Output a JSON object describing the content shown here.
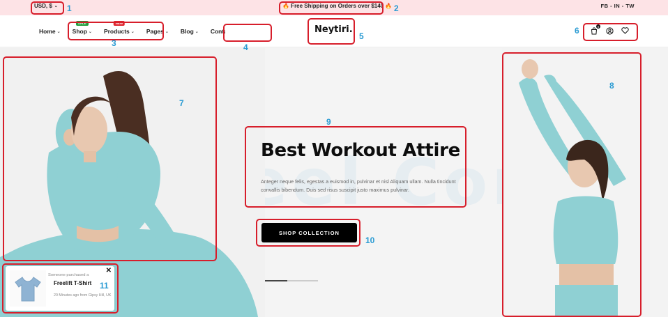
{
  "topbar": {
    "currency": "USD, $",
    "shipping_text": "🔥 Free Shipping on Orders over $140 🔥",
    "social": "FB - IN - TW"
  },
  "nav": {
    "items": [
      {
        "label": "Home",
        "has_dropdown": true
      },
      {
        "label": "Shop",
        "has_dropdown": true,
        "badge": "SALE"
      },
      {
        "label": "Products",
        "has_dropdown": true,
        "badge": "NEW"
      },
      {
        "label": "Pages",
        "has_dropdown": true
      },
      {
        "label": "Blog",
        "has_dropdown": true
      },
      {
        "label": "Contact",
        "has_dropdown": false
      }
    ]
  },
  "header": {
    "logo": "Neytiri.",
    "cart_count": "0",
    "icons": [
      "cart-icon",
      "user-icon",
      "heart-icon"
    ]
  },
  "hero": {
    "watermark": "Feel Comfy",
    "title": "Best Workout Attire",
    "description": "Anteger neque felis, egestas a euismod in, pulvinar et nisl Aliquam ullam. Nulla tincidunt convallis bibendum. Duis sed risus suscipit justo maximus pulvinar.",
    "cta": "SHOP COLLECTION"
  },
  "toast": {
    "line1": "Someone purchased a",
    "product": "Freelift T-Shirt",
    "meta": "20 Minutes ago from Gipsy Hill, UK",
    "close": "✕"
  },
  "annotations": [
    "1",
    "2",
    "3",
    "4",
    "5",
    "6",
    "7",
    "8",
    "9",
    "10",
    "11"
  ],
  "colors": {
    "topbar_bg": "#fde3e6",
    "annotation_box": "#d71e2b",
    "annotation_number": "#2a9bd3",
    "apparel": "#8fd0d3",
    "sale_badge": "#1f9d3a",
    "new_badge": "#e0262f"
  }
}
